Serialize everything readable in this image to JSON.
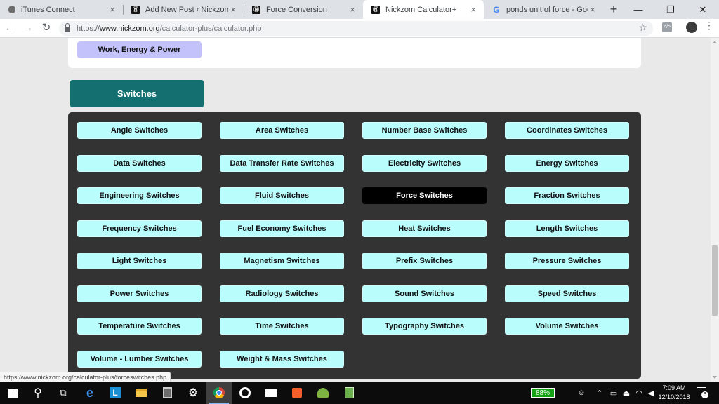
{
  "browser": {
    "tabs": [
      {
        "title": "iTunes Connect",
        "icon": "apple-icon",
        "active": false
      },
      {
        "title": "Add New Post ‹ Nickzom Blog",
        "icon": "nickzom-icon",
        "active": false
      },
      {
        "title": "Force Conversion",
        "icon": "nickzom-icon",
        "active": false
      },
      {
        "title": "Nickzom Calculator+",
        "icon": "nickzom-icon",
        "active": true
      },
      {
        "title": "ponds unit of force - Google S",
        "icon": "google-icon",
        "active": false
      }
    ],
    "url": {
      "scheme": "https://",
      "host": "www.nickzom.org",
      "path": "/calculator-plus/calculator.php"
    },
    "nav": {
      "back": "←",
      "forward": "→",
      "reload": "↻"
    },
    "window_controls": {
      "minimize": "—",
      "restore": "❐",
      "close": "✕"
    },
    "new_tab": "+",
    "bookmark_star": "☆",
    "menu": "⋮",
    "extension_label": "</>"
  },
  "page": {
    "top_button": "Work, Energy & Power",
    "section_heading": "Switches",
    "switches": [
      {
        "label": "Angle Switches",
        "active": false
      },
      {
        "label": "Area Switches",
        "active": false
      },
      {
        "label": "Number Base Switches",
        "active": false
      },
      {
        "label": "Coordinates Switches",
        "active": false
      },
      {
        "label": "Data Switches",
        "active": false
      },
      {
        "label": "Data Transfer Rate Switches",
        "active": false
      },
      {
        "label": "Electricity Switches",
        "active": false
      },
      {
        "label": "Energy Switches",
        "active": false
      },
      {
        "label": "Engineering Switches",
        "active": false
      },
      {
        "label": "Fluid Switches",
        "active": false
      },
      {
        "label": "Force Switches",
        "active": true
      },
      {
        "label": "Fraction Switches",
        "active": false
      },
      {
        "label": "Frequency Switches",
        "active": false
      },
      {
        "label": "Fuel Economy Switches",
        "active": false
      },
      {
        "label": "Heat Switches",
        "active": false
      },
      {
        "label": "Length Switches",
        "active": false
      },
      {
        "label": "Light Switches",
        "active": false
      },
      {
        "label": "Magnetism Switches",
        "active": false
      },
      {
        "label": "Prefix Switches",
        "active": false
      },
      {
        "label": "Pressure Switches",
        "active": false
      },
      {
        "label": "Power Switches",
        "active": false
      },
      {
        "label": "Radiology Switches",
        "active": false
      },
      {
        "label": "Sound Switches",
        "active": false
      },
      {
        "label": "Speed Switches",
        "active": false
      },
      {
        "label": "Temperature Switches",
        "active": false
      },
      {
        "label": "Time Switches",
        "active": false
      },
      {
        "label": "Typography Switches",
        "active": false
      },
      {
        "label": "Volume Switches",
        "active": false
      },
      {
        "label": "Volume - Lumber Switches",
        "active": false
      },
      {
        "label": "Weight & Mass Switches",
        "active": false
      }
    ],
    "status_url": "https://www.nickzom.org/calculator-plus/forceswitches.php"
  },
  "taskbar": {
    "battery": "88%",
    "time": "7:09 AM",
    "date": "12/10/2018",
    "notification_count": "6"
  },
  "colors": {
    "section_heading_bg": "#147070",
    "switch_bg": "#b9fdfd",
    "switch_active_bg": "#000000",
    "panel_bg": "#333333",
    "top_button_bg": "#c3c2fb"
  }
}
